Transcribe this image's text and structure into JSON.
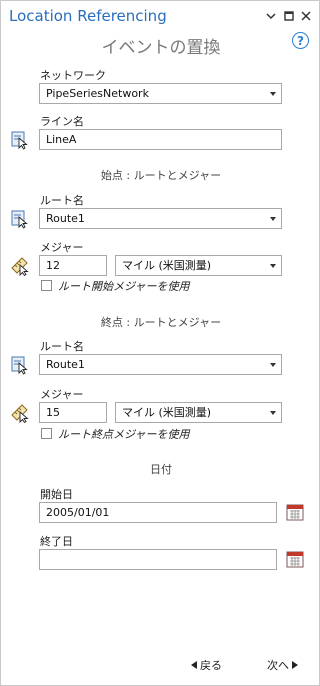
{
  "pane": {
    "title": "Location Referencing",
    "subtitle": "イベントの置換",
    "help_glyph": "?"
  },
  "network": {
    "label": "ネットワーク",
    "value": "PipeSeriesNetwork"
  },
  "line": {
    "label": "ライン名",
    "value": "LineA"
  },
  "from": {
    "section_label": "始点 : ルートとメジャー",
    "route_label": "ルート名",
    "route_value": "Route1",
    "measure_label": "メジャー",
    "measure_value": "12",
    "unit_value": "マイル (米国測量)",
    "checkbox_label": "ルート開始メジャーを使用"
  },
  "to": {
    "section_label": "終点 : ルートとメジャー",
    "route_label": "ルート名",
    "route_value": "Route1",
    "measure_label": "メジャー",
    "measure_value": "15",
    "unit_value": "マイル (米国測量)",
    "checkbox_label": "ルート終点メジャーを使用"
  },
  "dates": {
    "section_label": "日付",
    "start_label": "開始日",
    "start_value": "2005/01/01",
    "end_label": "終了日",
    "end_value": ""
  },
  "footer": {
    "back_label": "戻る",
    "next_label": "次へ"
  },
  "icons": {
    "map_pick": "map-select-tool-icon",
    "measure_pick": "measure-pick-tool-icon",
    "calendar": "calendar-icon"
  },
  "colors": {
    "title_blue": "#2a6ebb",
    "help_blue": "#2a7fd4"
  }
}
